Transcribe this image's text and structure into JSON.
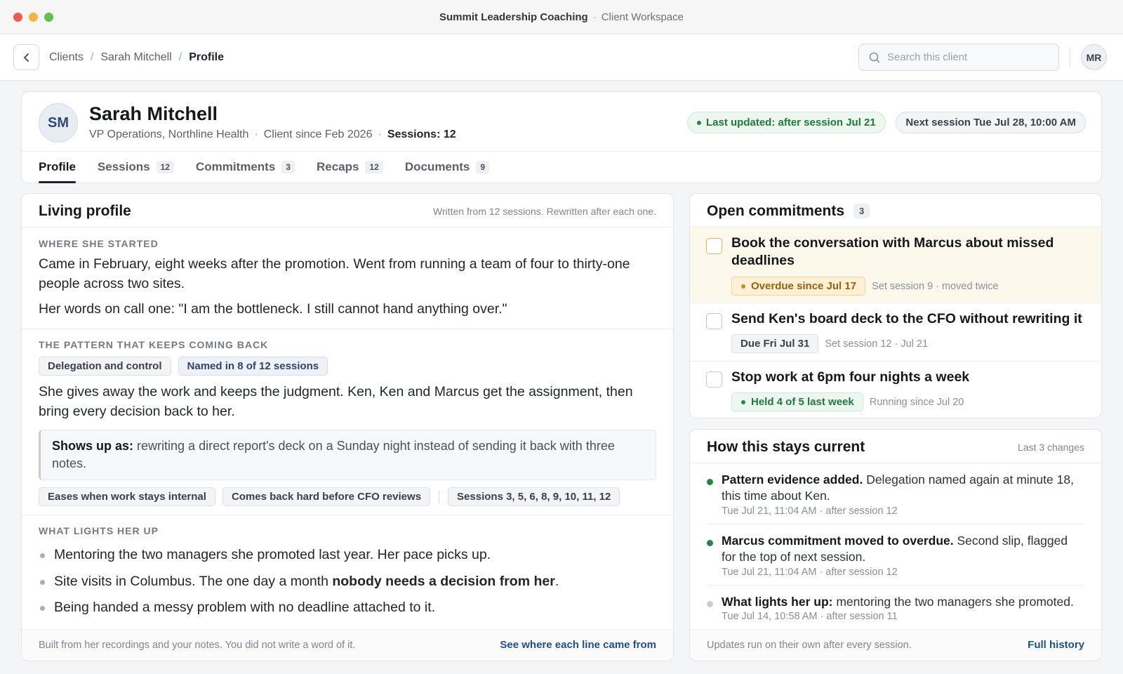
{
  "window": {
    "app_name": "Summit Leadership Coaching",
    "separator": "·",
    "workspace": "Client Workspace",
    "traffic_lights": {
      "close": "#ee5a52",
      "minimize": "#f4b73c",
      "zoom": "#5bc24a"
    }
  },
  "topbar": {
    "breadcrumb": [
      "Clients",
      "Sarah Mitchell",
      "Profile"
    ],
    "breadcrumb_separator": "/",
    "search_placeholder": "Search this client",
    "search_value": "",
    "user_initials": "MR"
  },
  "client": {
    "initials": "SM",
    "name": "Sarah Mitchell",
    "title": "VP Operations, Northline Health",
    "since": "Client since Feb 2026",
    "sessions": "Sessions: 12",
    "last_updated": "Last updated: after session Jul 21",
    "next_session": "Next session Tue Jul 28, 10:00 AM"
  },
  "tabs": [
    {
      "label": "Profile",
      "count": "",
      "active": true
    },
    {
      "label": "Sessions",
      "count": "12",
      "active": false
    },
    {
      "label": "Commitments",
      "count": "3",
      "active": false
    },
    {
      "label": "Recaps",
      "count": "12",
      "active": false
    },
    {
      "label": "Documents",
      "count": "9",
      "active": false
    }
  ],
  "profile": {
    "title": "Living profile",
    "note": "Written from 12 sessions. Rewritten after each one.",
    "started": {
      "label": "WHERE SHE STARTED",
      "p1": "Came in February, eight weeks after the promotion. Went from running a team of four to thirty-one people across two sites.",
      "p2": "Her words on call one: \"I am the bottleneck. I still cannot hand anything over.\""
    },
    "pattern": {
      "label": "THE PATTERN THAT KEEPS COMING BACK",
      "chip_name": "Delegation and control",
      "chip_count": "Named in 8 of 12 sessions",
      "text": "She gives away the work and keeps the judgment. Ken, Ken and Marcus get the assignment, then bring every decision back to her.",
      "shows_up_label": "Shows up as:",
      "shows_up_text": "rewriting a direct report's deck on a Sunday night instead of sending it back with three notes.",
      "tags": [
        "Eases when work stays internal",
        "Comes back hard before CFO reviews"
      ],
      "sessions_tag": "Sessions 3, 5, 6, 8, 9, 10, 11, 12"
    },
    "lights": {
      "label": "WHAT LIGHTS HER UP",
      "b1": "Mentoring the two managers she promoted last year. Her pace picks up.",
      "b2_pre": "Site visits in Columbus. The one day a month ",
      "b2_bold": "nobody needs a decision from her",
      "b2_post": ".",
      "b3": "Being handed a messy problem with no deadline attached to it."
    },
    "footer_note": "Built from her recordings and your notes. You did not write a word of it.",
    "footer_link": "See where each line came from"
  },
  "commitments": {
    "title": "Open commitments",
    "count": "3",
    "items": [
      {
        "title": "Book the conversation with Marcus about missed deadlines",
        "status": "Overdue since Jul 17",
        "meta": "Set session 9 · moved twice"
      },
      {
        "title": "Send Ken's board deck to the CFO without rewriting it",
        "status": "Due Fri Jul 31",
        "meta": "Set session 12 · Jul 21"
      },
      {
        "title": "Stop work at 6pm four nights a week",
        "status": "Held 4 of 5 last week",
        "meta": "Running since Jul 20"
      }
    ]
  },
  "current": {
    "title": "How this stays current",
    "note": "Last 3 changes",
    "changes": [
      {
        "bold": "Pattern evidence added.",
        "text": " Delegation named again at minute 18, this time about Ken.",
        "time": "Tue Jul 21, 11:04 AM · after session 12"
      },
      {
        "bold": "Marcus commitment moved to overdue.",
        "text": " Second slip, flagged for the top of next session.",
        "time": "Tue Jul 21, 11:04 AM · after session 12"
      },
      {
        "bold": "What lights her up:",
        "text": " mentoring the two managers she promoted.",
        "time": "Tue Jul 14, 10:58 AM · after session 11"
      }
    ],
    "footer_note": "Updates run on their own after every session.",
    "footer_link": "Full history"
  }
}
